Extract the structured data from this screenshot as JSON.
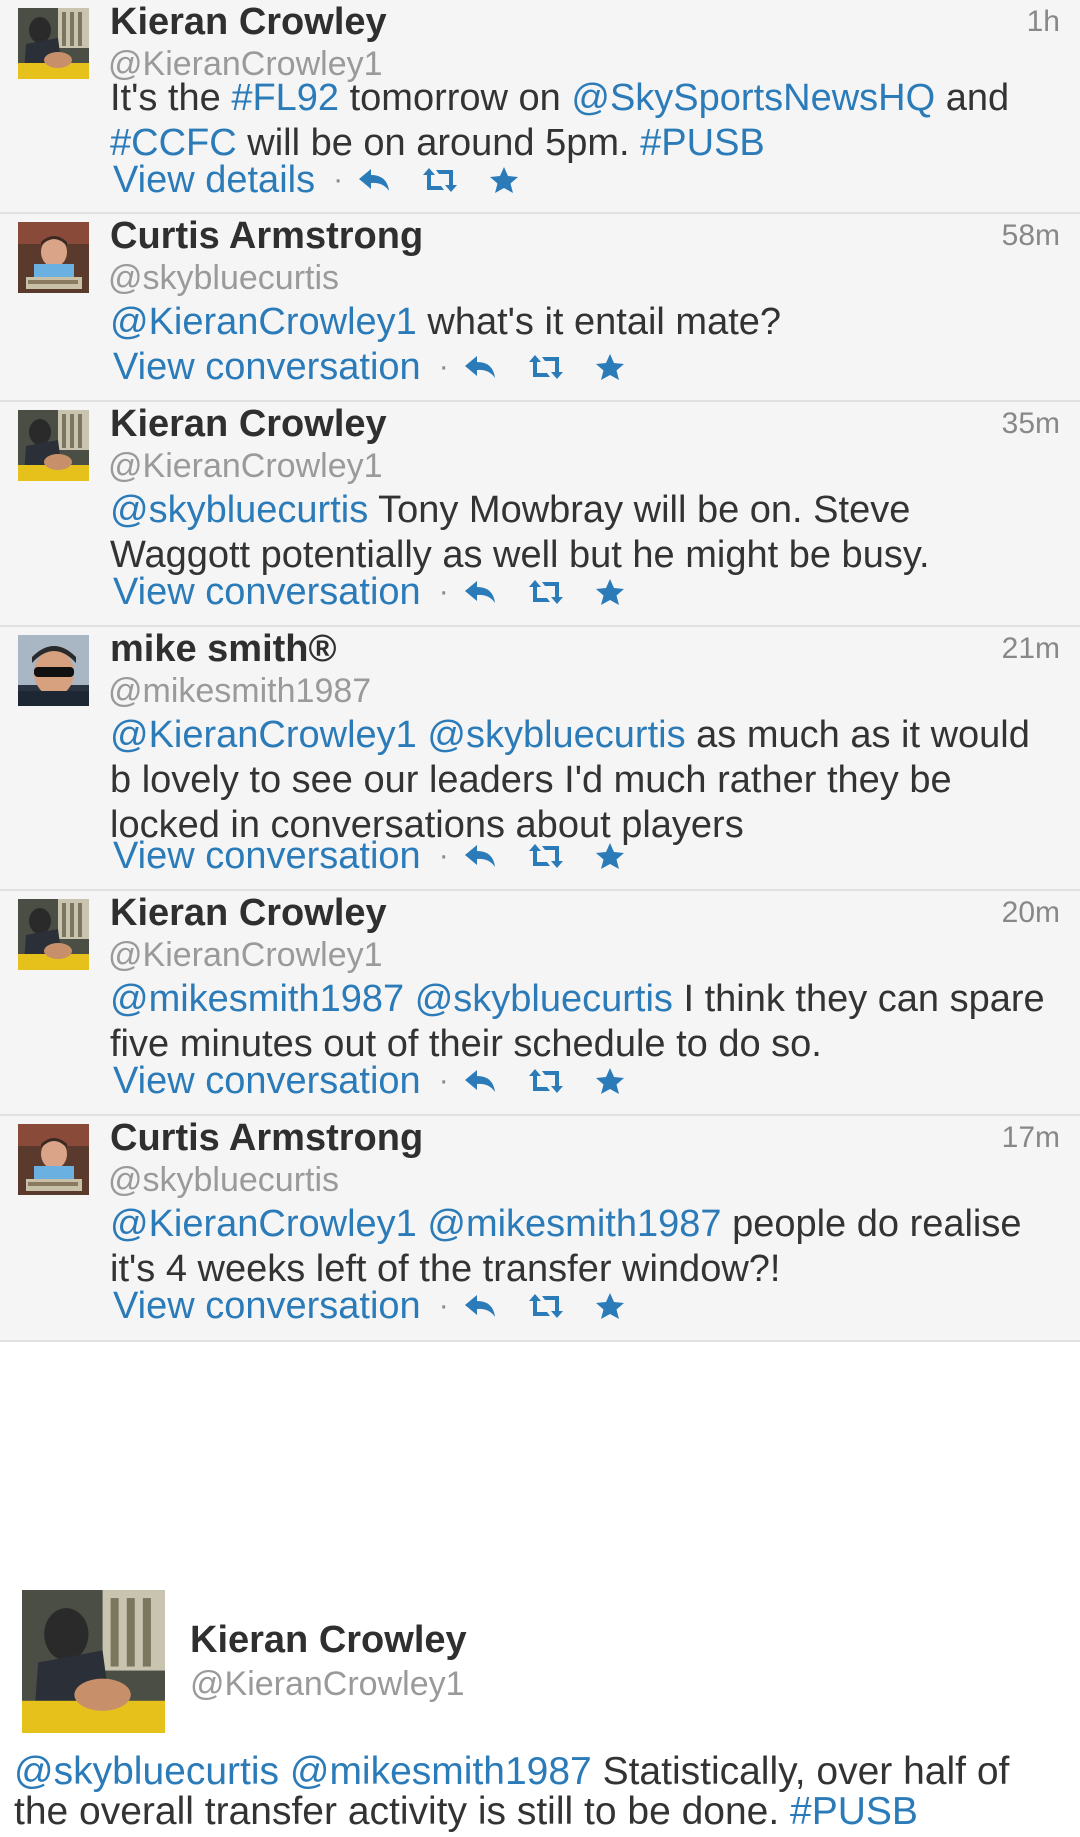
{
  "tweets": [
    {
      "name": "Kieran Crowley",
      "handle": "@KieranCrowley1",
      "time": "1h",
      "avatar": "kieran-avatar",
      "segments": [
        {
          "t": "It's the ",
          "k": "text"
        },
        {
          "t": "#FL92",
          "k": "hashtag"
        },
        {
          "t": " tomorrow on ",
          "k": "text"
        },
        {
          "t": "@SkySportsNewsHQ",
          "k": "mention"
        },
        {
          "t": " and ",
          "k": "text"
        },
        {
          "t": "#CCFC",
          "k": "hashtag"
        },
        {
          "t": " will be on around 5pm. ",
          "k": "text"
        },
        {
          "t": "#PUSB",
          "k": "hashtag"
        }
      ],
      "link": "View details"
    },
    {
      "name": "Curtis Armstrong",
      "handle": "@skybluecurtis",
      "time": "58m",
      "avatar": "curtis-avatar",
      "segments": [
        {
          "t": "@KieranCrowley1",
          "k": "mention"
        },
        {
          "t": " what's it entail mate?",
          "k": "text"
        }
      ],
      "link": "View conversation"
    },
    {
      "name": "Kieran Crowley",
      "handle": "@KieranCrowley1",
      "time": "35m",
      "avatar": "kieran-avatar",
      "segments": [
        {
          "t": "@skybluecurtis",
          "k": "mention"
        },
        {
          "t": " Tony Mowbray will be on. Steve Waggott potentially as well but he might be busy.",
          "k": "text"
        }
      ],
      "link": "View conversation"
    },
    {
      "name": "mike smith®",
      "handle": "@mikesmith1987",
      "time": "21m",
      "avatar": "mike-avatar",
      "segments": [
        {
          "t": "@KieranCrowley1",
          "k": "mention"
        },
        {
          "t": " ",
          "k": "text"
        },
        {
          "t": "@skybluecurtis",
          "k": "mention"
        },
        {
          "t": " as much as it would b lovely to see our leaders I'd much rather they be locked in conversations about players",
          "k": "text"
        }
      ],
      "link": "View conversation"
    },
    {
      "name": "Kieran Crowley",
      "handle": "@KieranCrowley1",
      "time": "20m",
      "avatar": "kieran-avatar",
      "segments": [
        {
          "t": "@mikesmith1987",
          "k": "mention"
        },
        {
          "t": " ",
          "k": "text"
        },
        {
          "t": "@skybluecurtis",
          "k": "mention"
        },
        {
          "t": " I think they can spare five minutes out of their schedule to do so.",
          "k": "text"
        }
      ],
      "link": "View conversation"
    },
    {
      "name": "Curtis Armstrong",
      "handle": "@skybluecurtis",
      "time": "17m",
      "avatar": "curtis-avatar",
      "segments": [
        {
          "t": "@KieranCrowley1",
          "k": "mention"
        },
        {
          "t": " ",
          "k": "text"
        },
        {
          "t": "@mikesmith1987",
          "k": "mention"
        },
        {
          "t": " people do realise it's 4 weeks left of the transfer window?!",
          "k": "text"
        }
      ],
      "link": "View conversation"
    }
  ],
  "expanded": {
    "name": "Kieran Crowley",
    "handle": "@KieranCrowley1",
    "avatar": "kieran-avatar",
    "segments": [
      {
        "t": "@skybluecurtis",
        "k": "mention"
      },
      {
        "t": " ",
        "k": "text"
      },
      {
        "t": "@mikesmith1987",
        "k": "mention"
      },
      {
        "t": " Statistically, over half of the overall transfer activity is still to be done. ",
        "k": "text"
      },
      {
        "t": "#PUSB",
        "k": "hashtag"
      }
    ]
  },
  "icons": {
    "reply": "reply-icon",
    "retweet": "retweet-icon",
    "favorite": "star-icon",
    "separator": "·"
  },
  "colors": {
    "link": "#2b7bb9",
    "background": "#f5f5f5",
    "divider": "#e1e1e1",
    "name": "#2f2f2f",
    "handle": "#9a9a9a"
  }
}
